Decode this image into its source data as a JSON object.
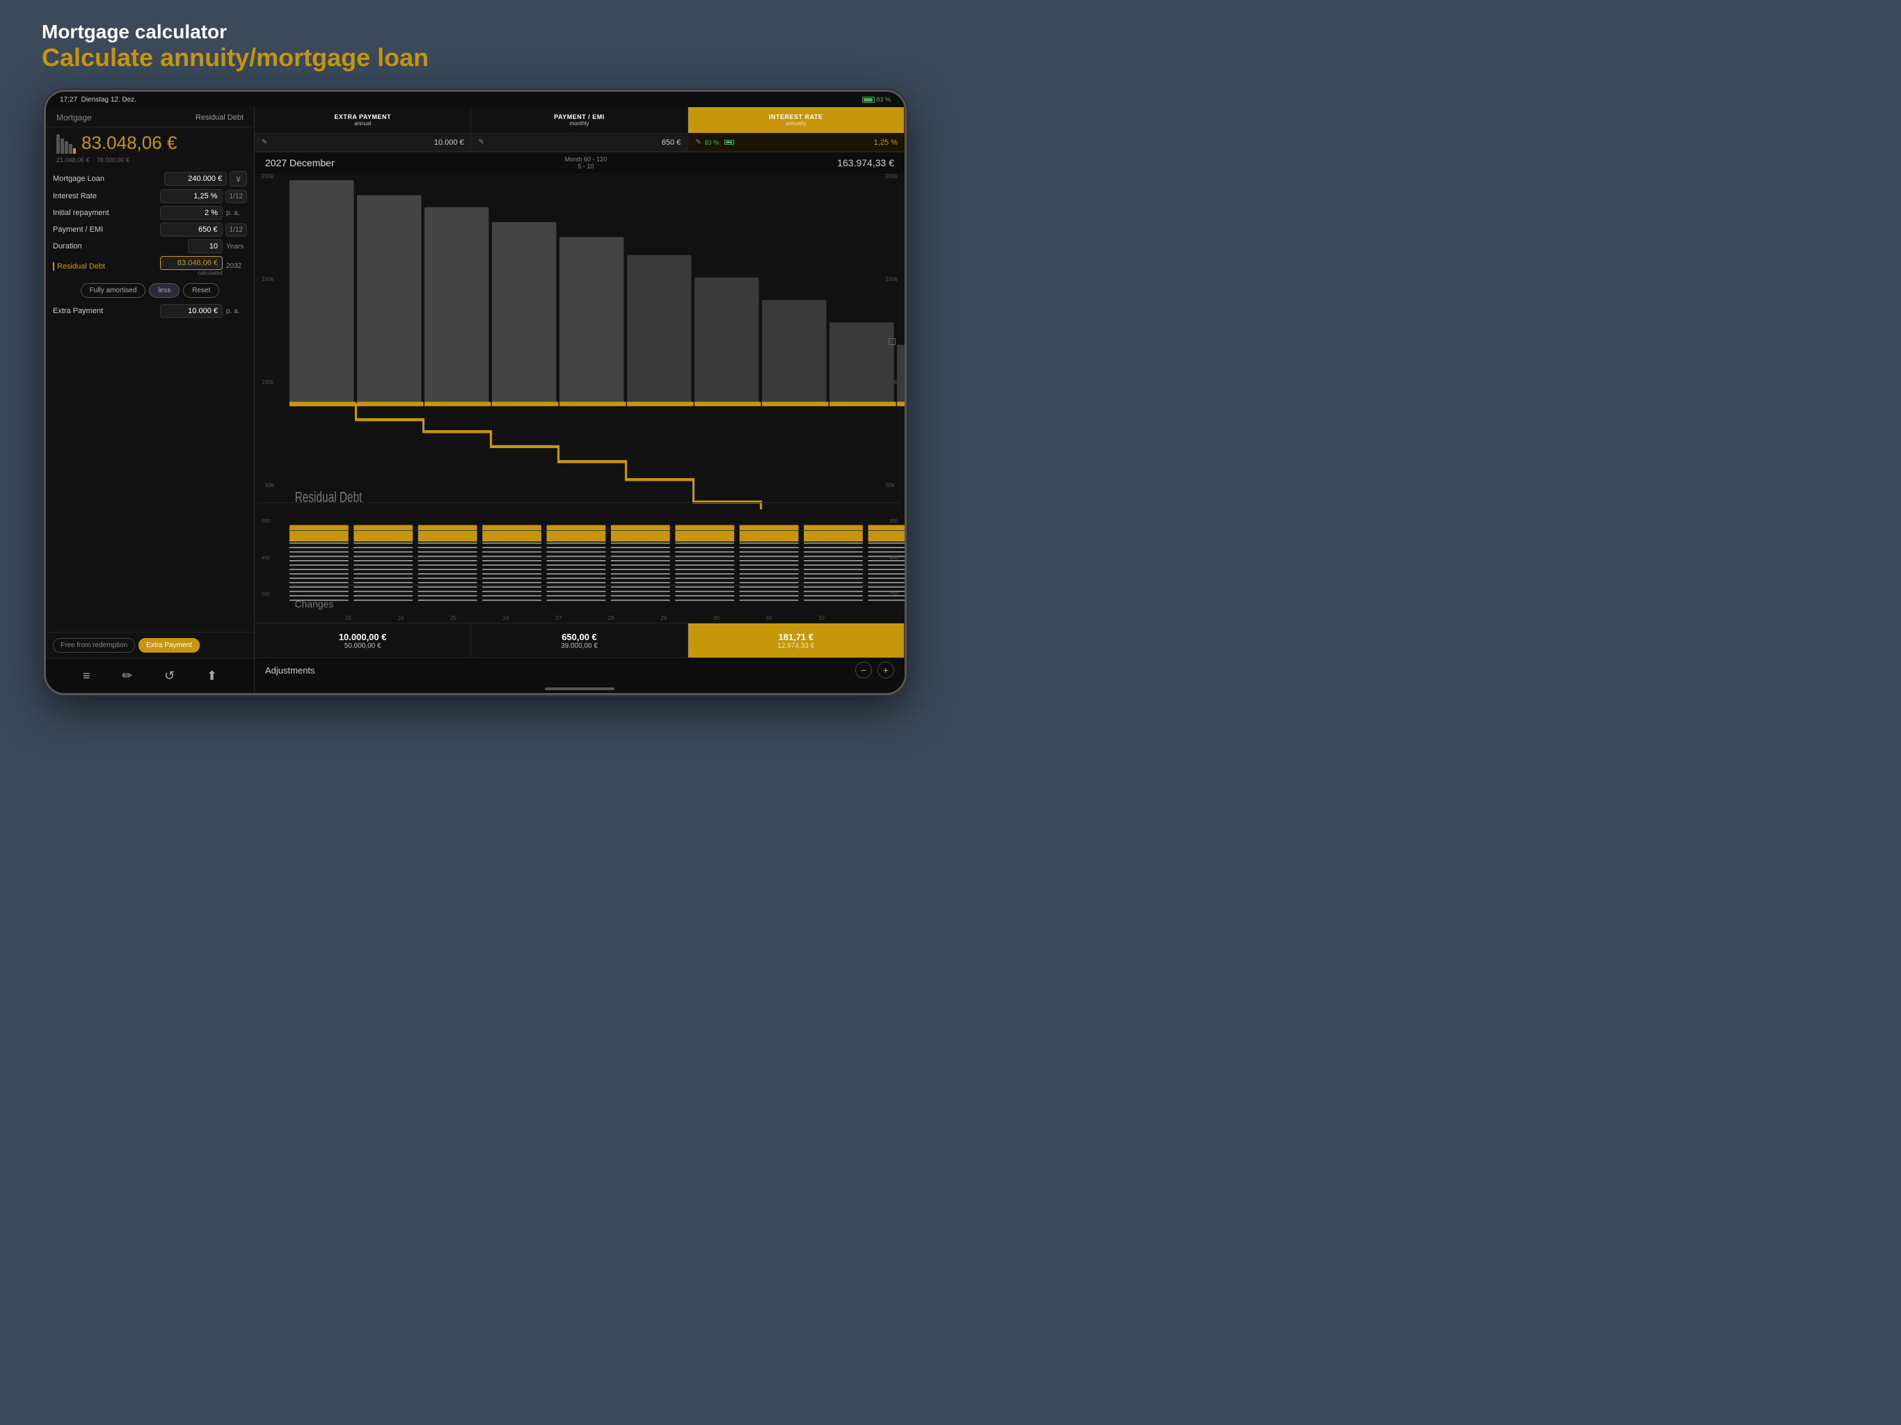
{
  "header": {
    "title": "Mortgage calculator",
    "subtitle": "Calculate annuity/mortgage loan"
  },
  "status_bar": {
    "time": "17:27",
    "date": "Dienstag 12. Dez.",
    "battery": "83 %"
  },
  "app": {
    "name": "Mortgage",
    "residual_label": "Residual Debt",
    "big_value": "83.048,06 €",
    "sub_val1": "21.048,06 €",
    "sub_val2": "78.000,00 €"
  },
  "fields": {
    "mortgage_loan": {
      "label": "Mortgage Loan",
      "value": "240.000 €",
      "unit": "∨"
    },
    "interest_rate": {
      "label": "Interest Rate",
      "value": "1,25 %",
      "unit": "1/12"
    },
    "initial_repayment": {
      "label": "Initial repayment",
      "value": "2 %",
      "unit": "p. a."
    },
    "payment_emi": {
      "label": "Payment / EMI",
      "value": "650 €",
      "unit": "1/12"
    },
    "duration": {
      "label": "Duration",
      "value": "10",
      "unit": "Years"
    },
    "residual_debt": {
      "label": "Residual Debt",
      "value": "83.048,06 €",
      "year": "2032",
      "note": "calculated"
    },
    "extra_payment": {
      "label": "Extra Payment",
      "value": "10.000 €",
      "unit": "p. a."
    }
  },
  "buttons": {
    "fully_amortised": "Fully amortised",
    "less": "less",
    "reset": "Reset",
    "free_from_redemption": "Free from redemption",
    "extra_payment": "Extra Payment"
  },
  "chart": {
    "date": "2027 December",
    "month_range": "Month 60 - 120",
    "year_range": "5 - 10",
    "total": "163.974,33 €",
    "y_labels": [
      "200k",
      "150k",
      "100k",
      "50k"
    ],
    "x_labels": [
      "23",
      "24",
      "25",
      "26",
      "27",
      "28",
      "29",
      "30",
      "31",
      "32"
    ],
    "residual_debt_label": "Residual Debt",
    "changes_label": "Changes"
  },
  "top_tabs": [
    {
      "title": "Extra Payment",
      "sub": "annual",
      "value": "10.000 €"
    },
    {
      "title": "Payment / EMI",
      "sub": "monthly",
      "value": "650 €"
    },
    {
      "title": "Interest Rate",
      "sub": "annually",
      "value": "1,25 %",
      "active": true,
      "battery": "83 %"
    }
  ],
  "bottom_values": [
    {
      "main": "10.000,00 €",
      "sub": "50.000,00 €"
    },
    {
      "main": "650,00 €",
      "sub": "39.000,00 €"
    },
    {
      "main": "181,71 €",
      "sub": "12.974,33 €",
      "gold": true
    }
  ],
  "adjustments_label": "Adjustments",
  "nav_icons": [
    "menu",
    "edit",
    "clock",
    "share"
  ],
  "ten_years_label": "10 Years"
}
